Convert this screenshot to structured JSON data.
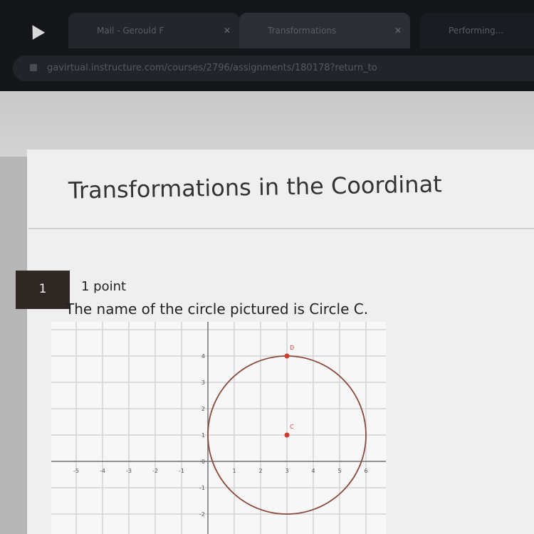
{
  "browser": {
    "tabs": [
      {
        "label": "Mail - Gerould F",
        "close": "✕"
      },
      {
        "label": "Transformations",
        "close": "✕"
      },
      {
        "label": "Performing..."
      }
    ],
    "url": "gavirtual.instructure.com/courses/2796/assignments/180178?return_to"
  },
  "page": {
    "title": "Transformations in the Coordinat",
    "question": {
      "number": "1",
      "points": "1 point",
      "prompt": "The name of the circle pictured is Circle C."
    }
  },
  "graph": {
    "x_ticks": [
      "-5",
      "-4",
      "-3",
      "-2",
      "-1",
      "1",
      "2",
      "3",
      "4",
      "5",
      "6"
    ],
    "y_ticks": [
      "4",
      "3",
      "2",
      "1",
      "0",
      "-1",
      "-2"
    ],
    "circle": {
      "center": {
        "x": 3,
        "y": 1
      },
      "radius": 3
    },
    "points": [
      {
        "label": "D",
        "x": 3,
        "y": 4
      },
      {
        "label": "C",
        "x": 3,
        "y": 1
      }
    ],
    "colors": {
      "circle": "#8a4a3c",
      "point": "#d23a2a",
      "grid": "#d3d3d3",
      "axis": "#777777"
    }
  }
}
